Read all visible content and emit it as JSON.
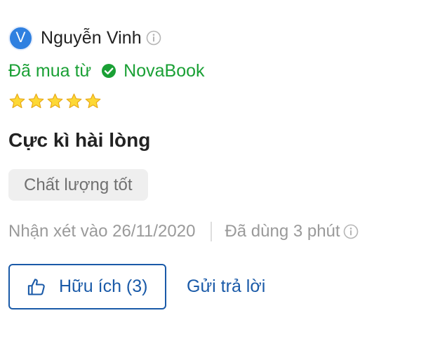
{
  "user": {
    "avatar_initial": "V",
    "name": "Nguyễn Vinh"
  },
  "purchase": {
    "label": "Đã mua từ",
    "store": "NovaBook"
  },
  "rating": {
    "stars": 5,
    "max": 5
  },
  "review": {
    "title": "Cực kì hài lòng",
    "tag": "Chất lượng tốt"
  },
  "meta": {
    "reviewed_on": "Nhận xét vào 26/11/2020",
    "used_for": "Đã dùng 3 phút"
  },
  "actions": {
    "helpful_label": "Hữu ích (3)",
    "reply_label": "Gửi trả lời"
  },
  "colors": {
    "avatar": "#2f80e0",
    "verified_green": "#1aa035",
    "star": "#fdd835",
    "link_blue": "#1a5aa8"
  },
  "icons": [
    "info-icon",
    "check-circle-icon",
    "star-icon",
    "thumbs-up-icon"
  ]
}
